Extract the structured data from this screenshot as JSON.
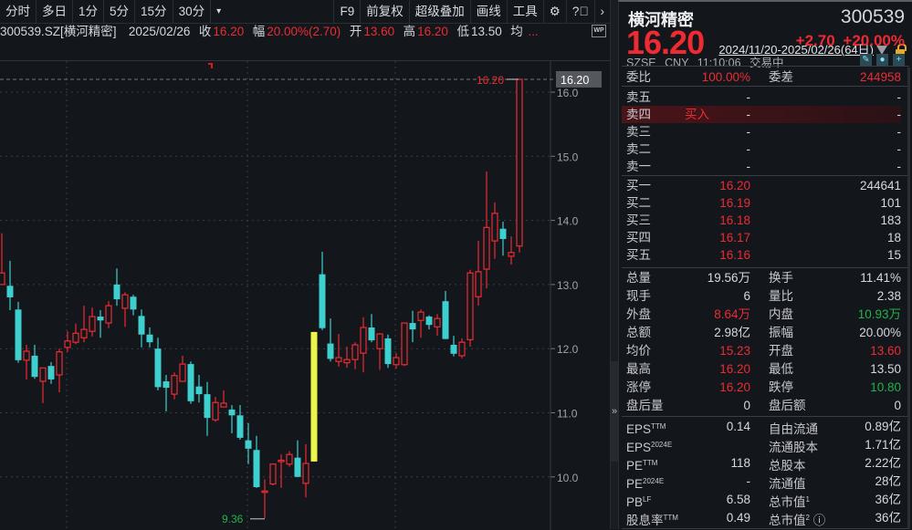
{
  "toolbar": {
    "periods": [
      "分时",
      "多日",
      "1分",
      "5分",
      "15分",
      "30分"
    ],
    "more": "▾",
    "right": [
      "F9",
      "前复权",
      "超级叠加",
      "画线",
      "工具"
    ],
    "settings_icon": "gear-icon",
    "help_icon": "help-icon",
    "next_icon": "chevron-right-icon"
  },
  "info": {
    "symbol": "300539.SZ[横河精密]",
    "date": "2025/02/26",
    "close_label": "收",
    "close": "16.20",
    "amp_label": "幅",
    "amp": "20.00%(2.70)",
    "open_label": "开",
    "open": "13.60",
    "high_label": "高",
    "high": "16.20",
    "low_label": "低",
    "low": "13.50",
    "avg_label": "均",
    "avg": "...",
    "wp": "WP"
  },
  "date_range": "2024/11/20-2025/02/26(64日)",
  "colors": {
    "up": "#ee2b33",
    "down": "#3ecfcf",
    "highlight": "#eef54a",
    "bg": "#13161b"
  },
  "chart_data": {
    "type": "candlestick",
    "ylim": [
      9.2,
      16.3
    ],
    "yticks": [
      "16.0",
      "15.0",
      "14.0",
      "13.0",
      "12.0",
      "11.0",
      "10.0"
    ],
    "ytick_values": [
      16,
      15,
      14,
      13,
      12,
      11,
      10
    ],
    "last_price_label": "16.20",
    "high_marker": "16.20",
    "low_marker": "9.36",
    "highlight_index": 38,
    "ohlc": [
      [
        13.0,
        13.18,
        13.8,
        13.0
      ],
      [
        12.98,
        12.8,
        13.37,
        12.6
      ],
      [
        12.61,
        11.82,
        12.73,
        11.78
      ],
      [
        11.82,
        11.96,
        12.06,
        11.52
      ],
      [
        11.89,
        11.56,
        12.06,
        11.53
      ],
      [
        11.49,
        11.7,
        11.7,
        11.15
      ],
      [
        11.73,
        11.52,
        11.79,
        11.45
      ],
      [
        11.59,
        11.95,
        12.0,
        11.32
      ],
      [
        12.02,
        12.12,
        12.27,
        11.95
      ],
      [
        12.1,
        12.24,
        12.39,
        12.07
      ],
      [
        12.17,
        12.3,
        12.67,
        12.1
      ],
      [
        12.27,
        12.5,
        12.64,
        12.19
      ],
      [
        12.5,
        12.44,
        12.6,
        12.17
      ],
      [
        12.4,
        12.67,
        12.74,
        12.32
      ],
      [
        13.0,
        12.77,
        13.25,
        12.67
      ],
      [
        12.63,
        12.84,
        12.88,
        12.34
      ],
      [
        12.81,
        12.61,
        12.84,
        12.52
      ],
      [
        12.51,
        12.22,
        12.61,
        12.02
      ],
      [
        12.22,
        12.1,
        12.33,
        12.02
      ],
      [
        12.0,
        11.4,
        12.17,
        11.35
      ],
      [
        11.49,
        11.39,
        11.59,
        11.02
      ],
      [
        11.29,
        11.58,
        11.63,
        11.21
      ],
      [
        11.49,
        11.76,
        11.89,
        11.49
      ],
      [
        11.76,
        11.18,
        11.8,
        11.14
      ],
      [
        11.41,
        11.29,
        11.59,
        11.16
      ],
      [
        11.29,
        10.92,
        11.48,
        10.64
      ],
      [
        10.89,
        11.16,
        11.25,
        10.86
      ],
      [
        11.09,
        11.15,
        11.35,
        11.09
      ],
      [
        11.05,
        10.96,
        11.12,
        10.68
      ],
      [
        10.96,
        10.61,
        11.12,
        10.58
      ],
      [
        10.57,
        10.44,
        10.84,
        10.2
      ],
      [
        10.42,
        9.84,
        10.64,
        9.83
      ],
      [
        9.77,
        9.78,
        9.96,
        9.36
      ],
      [
        9.89,
        10.2,
        10.2,
        9.87
      ],
      [
        10.25,
        10.26,
        10.35,
        9.83
      ],
      [
        10.2,
        10.35,
        10.4,
        10.16
      ],
      [
        10.3,
        10.0,
        10.57,
        10.0
      ],
      [
        9.9,
        10.21,
        10.51,
        9.68
      ],
      [
        10.24,
        12.26,
        12.26,
        10.24
      ],
      [
        13.16,
        12.32,
        13.51,
        12.29
      ],
      [
        12.08,
        11.84,
        12.47,
        11.8
      ],
      [
        11.8,
        11.86,
        12.23,
        11.72
      ],
      [
        11.78,
        11.83,
        12.03,
        11.7
      ],
      [
        11.83,
        12.06,
        12.1,
        11.68
      ],
      [
        11.93,
        12.33,
        12.49,
        11.63
      ],
      [
        12.33,
        12.13,
        12.54,
        12.1
      ],
      [
        12.0,
        12.23,
        12.23,
        11.67
      ],
      [
        12.16,
        11.76,
        12.22,
        11.7
      ],
      [
        11.75,
        11.86,
        11.93,
        11.69
      ],
      [
        11.75,
        12.4,
        12.4,
        11.73
      ],
      [
        12.4,
        12.3,
        12.59,
        12.1
      ],
      [
        12.44,
        12.57,
        12.61,
        12.17
      ],
      [
        12.5,
        12.37,
        12.52,
        12.3
      ],
      [
        12.34,
        12.47,
        12.54,
        12.2
      ],
      [
        12.74,
        12.15,
        12.9,
        12.15
      ],
      [
        12.06,
        11.92,
        12.2,
        11.88
      ],
      [
        11.89,
        12.1,
        12.16,
        11.85
      ],
      [
        12.14,
        13.18,
        13.23,
        12.03
      ],
      [
        12.81,
        13.2,
        13.68,
        12.67
      ],
      [
        13.24,
        13.89,
        14.76,
        12.94
      ],
      [
        13.68,
        14.11,
        14.28,
        13.4
      ],
      [
        13.87,
        13.71,
        13.98,
        13.45
      ],
      [
        13.44,
        13.5,
        13.75,
        13.31
      ],
      [
        13.6,
        16.2,
        16.2,
        13.5
      ]
    ]
  },
  "quote": {
    "name": "横河精密",
    "code": "300539",
    "price": "16.20",
    "change": "+2.70",
    "change_pct": "+20.00%",
    "exchange": "SZSE",
    "currency": "CNY",
    "time": "11:10:06",
    "state": "交易中"
  },
  "order_book": {
    "ratio_label": "委比",
    "ratio": "100.00%",
    "diff_label": "委差",
    "diff": "244958",
    "asks": [
      {
        "label": "卖五",
        "price": "-",
        "vol": "-"
      },
      {
        "label": "卖四",
        "price": "-",
        "vol": "-",
        "tag": "买入"
      },
      {
        "label": "卖三",
        "price": "-",
        "vol": "-"
      },
      {
        "label": "卖二",
        "price": "-",
        "vol": "-"
      },
      {
        "label": "卖一",
        "price": "-",
        "vol": "-"
      }
    ],
    "bids": [
      {
        "label": "买一",
        "price": "16.20",
        "vol": "244641"
      },
      {
        "label": "买二",
        "price": "16.19",
        "vol": "101"
      },
      {
        "label": "买三",
        "price": "16.18",
        "vol": "183"
      },
      {
        "label": "买四",
        "price": "16.17",
        "vol": "18"
      },
      {
        "label": "买五",
        "price": "16.16",
        "vol": "15"
      }
    ]
  },
  "stats": [
    {
      "l1": "总量",
      "v1": "19.56万",
      "c1": "",
      "l2": "换手",
      "v2": "11.41%",
      "c2": ""
    },
    {
      "l1": "现手",
      "v1": "6",
      "c1": "",
      "l2": "量比",
      "v2": "2.38",
      "c2": ""
    },
    {
      "l1": "外盘",
      "v1": "8.64万",
      "c1": "red",
      "l2": "内盘",
      "v2": "10.93万",
      "c2": "green"
    },
    {
      "l1": "总额",
      "v1": "2.98亿",
      "c1": "",
      "l2": "振幅",
      "v2": "20.00%",
      "c2": ""
    },
    {
      "l1": "均价",
      "v1": "15.23",
      "c1": "red",
      "l2": "开盘",
      "v2": "13.60",
      "c2": "red"
    },
    {
      "l1": "最高",
      "v1": "16.20",
      "c1": "red",
      "l2": "最低",
      "v2": "13.50",
      "c2": ""
    },
    {
      "l1": "涨停",
      "v1": "16.20",
      "c1": "red",
      "l2": "跌停",
      "v2": "10.80",
      "c2": "green"
    },
    {
      "l1": "盘后量",
      "v1": "0",
      "c1": "",
      "l2": "盘后额",
      "v2": "0",
      "c2": ""
    }
  ],
  "fundamentals": [
    {
      "l1": "EPS",
      "s1": "TTM",
      "v1": "0.14",
      "l2": "自由流通",
      "s2": "",
      "v2": "0.89亿"
    },
    {
      "l1": "EPS",
      "s1": "2024E",
      "v1": "",
      "l2": "流通股本",
      "s2": "",
      "v2": "1.71亿"
    },
    {
      "l1": "PE",
      "s1": "TTM",
      "v1": "118",
      "l2": "总股本",
      "s2": "",
      "v2": "2.22亿"
    },
    {
      "l1": "PE",
      "s1": "2024E",
      "v1": "-",
      "l2": "流通值",
      "s2": "",
      "v2": "28亿"
    },
    {
      "l1": "PB",
      "s1": "LF",
      "v1": "6.58",
      "l2": "总市值",
      "s2": "1",
      "v2": "36亿"
    },
    {
      "l1": "股息率",
      "s1": "TTM",
      "v1": "0.49",
      "l2": "总市值",
      "s2": "2",
      "v2": "36亿"
    }
  ]
}
